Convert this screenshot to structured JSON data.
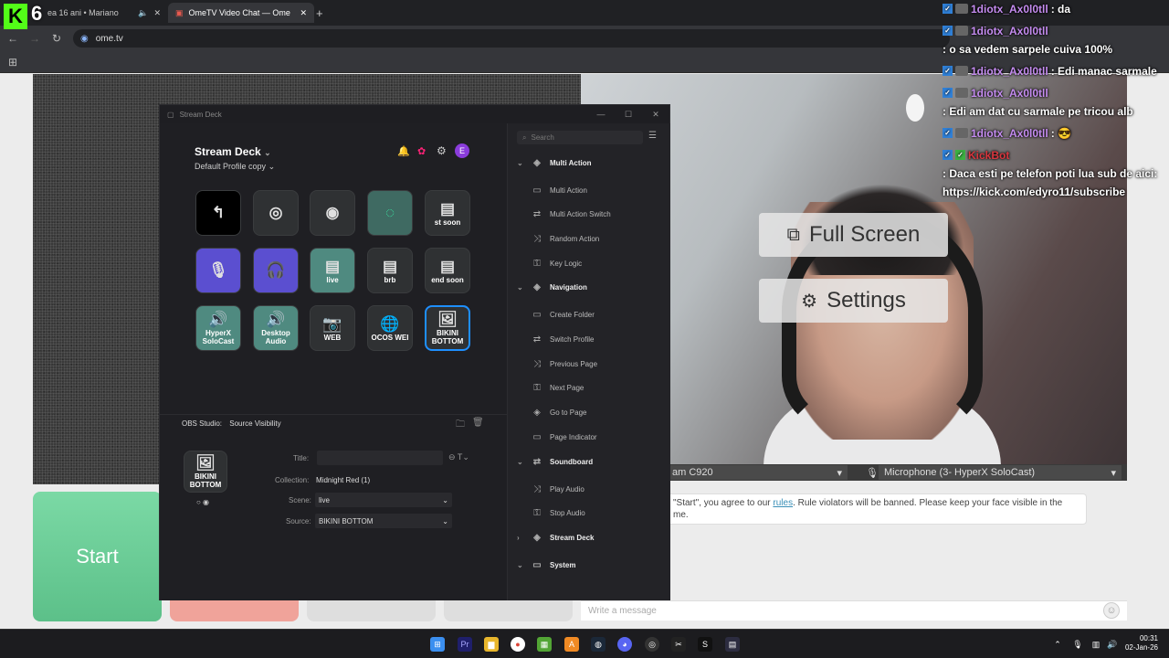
{
  "browser": {
    "tabs": [
      {
        "label": "ea 16 ani • Mariano"
      },
      {
        "label": "OmeTV Video Chat — Ome"
      }
    ],
    "url": "ome.tv"
  },
  "kick": {
    "logo": "K",
    "viewer_count": "6"
  },
  "chat": [
    {
      "user": "1diotx_Ax0l0tll",
      "text": ": da"
    },
    {
      "user": "1diotx_Ax0l0tll",
      "text": ": o sa vedem sarpele cuiva 100%"
    },
    {
      "user": "1diotx_Ax0l0tll",
      "text": ": Edi manac sarmale"
    },
    {
      "user": "1diotx_Ax0l0tll",
      "text": ": Edi am dat cu sarmale pe tricou alb"
    },
    {
      "user": "1diotx_Ax0l0tll",
      "text": ": 😎"
    },
    {
      "user": "KickBot",
      "text": ": Daca esti pe telefon poti lua sub de aici: https://kick.com/edyro11/subscribe"
    }
  ],
  "ome": {
    "fullscreen_label": "Full Screen",
    "settings_label": "Settings",
    "camera_select": "am C920",
    "mic_select": "Microphone (3- HyperX SoloCast)",
    "rules_prefix": "\"Start\", you agree to our ",
    "rules_link": "rules",
    "rules_suffix": ". Rule violators will be banned. Please keep your face visible in the",
    "rules_line2": "me.",
    "message_placeholder": "Write a message",
    "start_label": "Start"
  },
  "stream_deck": {
    "window_title": "Stream Deck",
    "device_name": "Stream Deck",
    "profile": "Default Profile copy",
    "avatar_letter": "E",
    "keys": [
      {
        "label": "",
        "icon": "back-icon"
      },
      {
        "label": "",
        "icon": "record-icon"
      },
      {
        "label": "",
        "icon": "pause-record-icon"
      },
      {
        "label": "",
        "icon": "replay-icon"
      },
      {
        "label": "st soon",
        "icon": "scene-icon"
      },
      {
        "label": "",
        "icon": "mic-icon"
      },
      {
        "label": "",
        "icon": "headphones-icon"
      },
      {
        "label": "live",
        "icon": "scene-icon"
      },
      {
        "label": "brb",
        "icon": "scene-icon"
      },
      {
        "label": "end soon",
        "icon": "scene-icon"
      },
      {
        "label": "HyperX SoloCast",
        "icon": "audio-icon"
      },
      {
        "label": "Desktop Audio",
        "icon": "audio-icon"
      },
      {
        "label": "WEB",
        "icon": "camera-icon"
      },
      {
        "label": "OCOS WEI",
        "icon": "globe-icon"
      },
      {
        "label": "BIKINI BOTTOM",
        "icon": "image-icon"
      }
    ],
    "inspector": {
      "plugin": "OBS Studio:",
      "action": "Source Visibility",
      "title_label": "Title:",
      "collection_label": "Collection:",
      "collection_value": "Midnight Red (1)",
      "scene_label": "Scene:",
      "scene_value": "live",
      "source_label": "Source:",
      "source_value": "BIKINI BOTTOM",
      "preview_label": "BIKINI BOTTOM"
    },
    "search_placeholder": "Search",
    "actions_panel": [
      {
        "type": "cat",
        "label": "Multi Action"
      },
      {
        "type": "item",
        "label": "Multi Action"
      },
      {
        "type": "item",
        "label": "Multi Action Switch"
      },
      {
        "type": "item",
        "label": "Random Action"
      },
      {
        "type": "item",
        "label": "Key Logic"
      },
      {
        "type": "cat",
        "label": "Navigation"
      },
      {
        "type": "item",
        "label": "Create Folder"
      },
      {
        "type": "item",
        "label": "Switch Profile"
      },
      {
        "type": "item",
        "label": "Previous Page"
      },
      {
        "type": "item",
        "label": "Next Page"
      },
      {
        "type": "item",
        "label": "Go to Page"
      },
      {
        "type": "item",
        "label": "Page Indicator"
      },
      {
        "type": "cat",
        "label": "Soundboard"
      },
      {
        "type": "item",
        "label": "Play Audio"
      },
      {
        "type": "item",
        "label": "Stop Audio"
      },
      {
        "type": "cat",
        "label": "Stream Deck"
      },
      {
        "type": "cat",
        "label": "System"
      }
    ]
  },
  "taskbar": {
    "time": "00:31",
    "date": "02-Jan-26"
  }
}
